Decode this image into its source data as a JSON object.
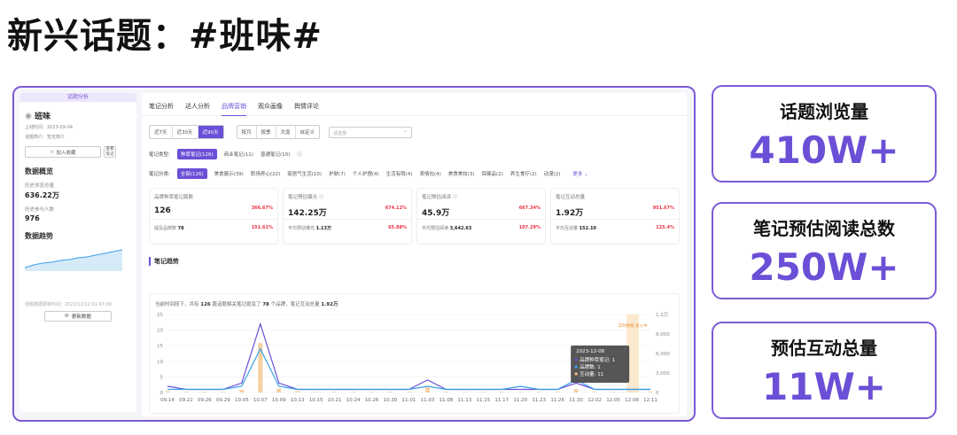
{
  "page_title": "新兴话题：#班味#",
  "left": {
    "header": "话题分析",
    "topic_name": "班味",
    "online_time": "上线时间：2023-09-04",
    "intro": "话题简介：暂无简介",
    "fav_label": "加入收藏",
    "qr_label": "查看 笔记",
    "overview_title": "数据概览",
    "views_label": "历史浏览总量",
    "views_value": "636.22万",
    "participants_label": "历史参与人数",
    "participants_value": "976",
    "trend_title": "数据趋势",
    "update_time": "话题数据更新时间：2023/12/12 01:47:09",
    "refresh_label": "更新数据"
  },
  "tabs": [
    "笔记分析",
    "达人分析",
    "品牌营销",
    "观众画像",
    "舆情评论"
  ],
  "active_tab": 2,
  "time_ranges": [
    "近7天",
    "近30天",
    "近90天"
  ],
  "active_time_range": 2,
  "periods": [
    "按月",
    "按季",
    "大促",
    "自定义"
  ],
  "select_placeholder": "请选择",
  "note_type": {
    "label": "笔记类型:",
    "options": [
      "种草笔记(126)",
      "商业笔记(11)",
      "普通笔记(10)"
    ],
    "help": "ⓘ"
  },
  "note_category": {
    "label": "笔记分类:",
    "options": [
      "全部(126)",
      "美食展示(39)",
      "职场养心(22)",
      "家居气生活(10)",
      "护肤(7)",
      "个人护理(4)",
      "生活有限(4)",
      "表情包(4)",
      "美食美妆(3)",
      "保健品(2)",
      "养生食疗(2)",
      "动漫(2)"
    ],
    "more": "更多 ⌄"
  },
  "cards": [
    {
      "title": "品牌种草笔记篇数",
      "value": "126",
      "pct": "366.67%",
      "sub_label": "提及品牌数",
      "sub_value": "78",
      "sub_pct": "151.61%"
    },
    {
      "title": "笔记预估曝光 ⓘ",
      "value": "142.25万",
      "pct": "674.12%",
      "sub_label": "平均预估曝光",
      "sub_value": "1.13万",
      "sub_pct": "65.88%"
    },
    {
      "title": "笔记预估阅读 ⓘ",
      "value": "45.9万",
      "pct": "667.34%",
      "sub_label": "平均预估阅读",
      "sub_value": "3,642.63",
      "sub_pct": "107.29%"
    },
    {
      "title": "笔记互动总量",
      "value": "1.92万",
      "pct": "951.67%",
      "sub_label": "平均互动量",
      "sub_value": "152.10",
      "sub_pct": "125.4%"
    }
  ],
  "trend_title": "笔记趋势",
  "chart_note": {
    "p1": "当前时间段下，共有 ",
    "n1": "126",
    "p2": " 篇话题相关笔记提及了 ",
    "n2": "78",
    "p3": " 个品牌，笔记互动总量 ",
    "n3": "1.92万"
  },
  "chart_data": {
    "type": "line",
    "x": [
      "09.14",
      "09.22",
      "09.26",
      "09.29",
      "10.05",
      "10.07",
      "10.09",
      "10.13",
      "10.15",
      "10.21",
      "10.24",
      "10.26",
      "10.30",
      "11.01",
      "11.03",
      "11.08",
      "11.13",
      "11.15",
      "11.17",
      "11.20",
      "11.23",
      "11.26",
      "11.30",
      "12.02",
      "12.05",
      "12.08",
      "12.11"
    ],
    "left_axis": {
      "ticks": [
        "25",
        "20",
        "15",
        "10",
        "5",
        "0"
      ],
      "min": 0,
      "max": 25
    },
    "right_axis": {
      "ticks": [
        "1.2万",
        "9,000",
        "6,000",
        "3,000",
        "0"
      ],
      "min": 0,
      "max": 12000
    },
    "series": [
      {
        "name": "品牌种草笔记",
        "axis": "left",
        "color": "#6b4fd6",
        "values": [
          2,
          1,
          1,
          1,
          3,
          22,
          3,
          1,
          1,
          1,
          1,
          1,
          1,
          1,
          4,
          1,
          1,
          1,
          1,
          1,
          1,
          1,
          3,
          1,
          1,
          1,
          1
        ]
      },
      {
        "name": "品牌数",
        "axis": "left",
        "color": "#3aa0e8",
        "values": [
          1,
          1,
          1,
          1,
          2,
          14,
          2,
          1,
          1,
          1,
          1,
          1,
          1,
          1,
          2,
          1,
          1,
          1,
          1,
          2,
          1,
          1,
          4,
          1,
          1,
          1,
          1
        ]
      },
      {
        "name": "互动量",
        "axis": "right",
        "color": "#f2c48a",
        "type": "bar",
        "values": [
          200,
          100,
          100,
          100,
          400,
          7600,
          600,
          200,
          100,
          100,
          100,
          100,
          100,
          100,
          800,
          100,
          100,
          100,
          100,
          100,
          100,
          100,
          500,
          100,
          100,
          100,
          100
        ]
      }
    ],
    "tooltip": {
      "date": "2023-12-08",
      "lines": [
        "品牌种草笔记: 1",
        "品牌数: 1",
        "互动量: 11"
      ]
    },
    "marker": {
      "label": "实时数据 录入中"
    }
  },
  "right_cards": [
    {
      "label": "话题浏览量",
      "value": "410W+"
    },
    {
      "label": "笔记预估阅读总数",
      "value": "250W+"
    },
    {
      "label": "预估互动总量",
      "value": "11W+"
    }
  ]
}
